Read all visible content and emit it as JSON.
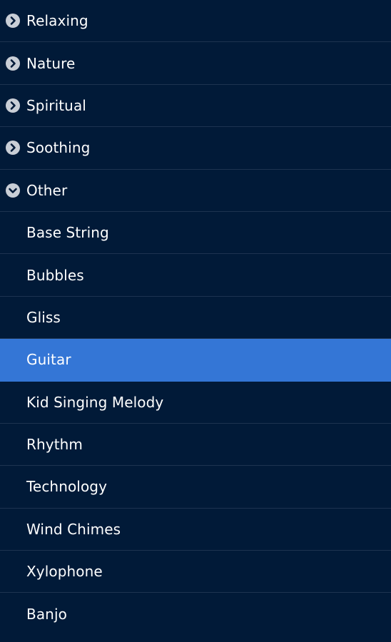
{
  "colors": {
    "background": "#011a38",
    "divider": "#1d3350",
    "selected": "#3476d6",
    "text": "#ffffff",
    "icon_fill": "#c9ced6",
    "icon_glyph": "#011a38"
  },
  "groups": [
    {
      "label": "Relaxing",
      "icon": "chevron-right-circle-icon"
    },
    {
      "label": "Nature",
      "icon": "chevron-right-circle-icon"
    },
    {
      "label": "Spiritual",
      "icon": "chevron-right-circle-icon"
    },
    {
      "label": "Soothing",
      "icon": "chevron-right-circle-icon"
    },
    {
      "label": "Other",
      "icon": "chevron-down-circle-icon"
    }
  ],
  "children": [
    {
      "label": "Base String"
    },
    {
      "label": "Bubbles"
    },
    {
      "label": "Gliss"
    },
    {
      "label": "Guitar"
    },
    {
      "label": "Kid Singing Melody"
    },
    {
      "label": "Rhythm"
    },
    {
      "label": "Technology"
    },
    {
      "label": "Wind Chimes"
    },
    {
      "label": "Xylophone"
    },
    {
      "label": "Banjo"
    }
  ],
  "selected_child": "Guitar"
}
